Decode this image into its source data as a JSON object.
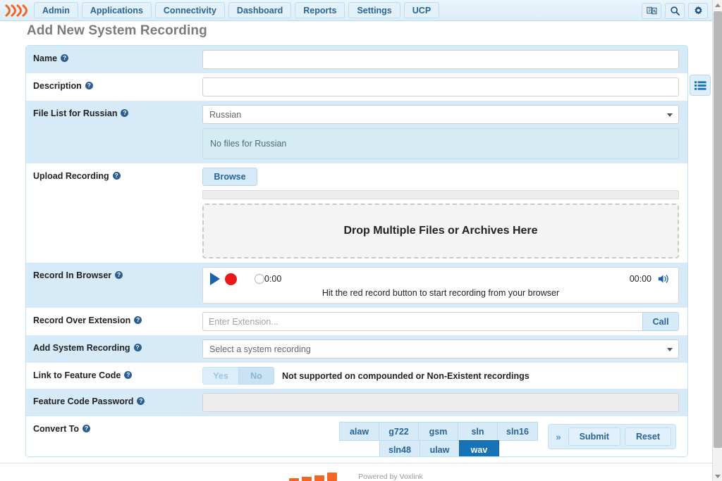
{
  "nav": {
    "logo_name": "signal-waves-logo",
    "tabs": [
      {
        "label": "Admin"
      },
      {
        "label": "Applications"
      },
      {
        "label": "Connectivity"
      },
      {
        "label": "Dashboard"
      },
      {
        "label": "Reports"
      },
      {
        "label": "Settings"
      },
      {
        "label": "UCP"
      }
    ],
    "right_icons": [
      {
        "name": "language-icon"
      },
      {
        "name": "search-icon"
      },
      {
        "name": "gear-icon"
      }
    ]
  },
  "page": {
    "title": "Add New System Recording"
  },
  "form": {
    "name": {
      "label": "Name",
      "value": "",
      "placeholder": ""
    },
    "description": {
      "label": "Description",
      "value": "",
      "placeholder": ""
    },
    "file_list": {
      "label": "File List for Russian",
      "selected": "Russian",
      "empty_message": "No files for Russian"
    },
    "upload_recording": {
      "label": "Upload Recording",
      "browse_label": "Browse",
      "dropzone_text": "Drop Multiple Files or Archives Here"
    },
    "record_in_browser": {
      "label": "Record In Browser",
      "current_time": "0:00",
      "total_time": "00:00",
      "hint": "Hit the red record button to start recording from your browser",
      "play_icon": "play-icon",
      "record_icon": "record-icon",
      "volume_icon": "volume-icon"
    },
    "record_over_extension": {
      "label": "Record Over Extension",
      "value": "",
      "placeholder": "Enter Extension...",
      "call_label": "Call"
    },
    "add_system_recording": {
      "label": "Add System Recording",
      "selected": "Select a system recording"
    },
    "link_feature_code": {
      "label": "Link to Feature Code",
      "yes_label": "Yes",
      "no_label": "No",
      "note": "Not supported on compounded or Non-Existent recordings"
    },
    "feature_code_password": {
      "label": "Feature Code Password",
      "value": "",
      "placeholder": ""
    },
    "convert_to": {
      "label": "Convert To",
      "row1": [
        {
          "label": "alaw",
          "active": false
        },
        {
          "label": "g722",
          "active": false
        },
        {
          "label": "gsm",
          "active": false
        },
        {
          "label": "sln",
          "active": false
        },
        {
          "label": "sln16",
          "active": false
        }
      ],
      "row2": [
        {
          "label": "sln48",
          "active": false
        },
        {
          "label": "ulaw",
          "active": false
        },
        {
          "label": "wav",
          "active": true
        }
      ]
    }
  },
  "actions": {
    "expand_label": "»",
    "submit_label": "Submit",
    "reset_label": "Reset"
  },
  "side_tab": {
    "icon": "list-icon"
  },
  "footer": {
    "powered_by": "Powered by Voxlink"
  },
  "colors": {
    "accent": "#1673b5",
    "nav_text": "#2a6496",
    "row_alt_bg": "#d6eaf8",
    "record_red": "#e8191a",
    "logo_orange": "#f26522"
  }
}
